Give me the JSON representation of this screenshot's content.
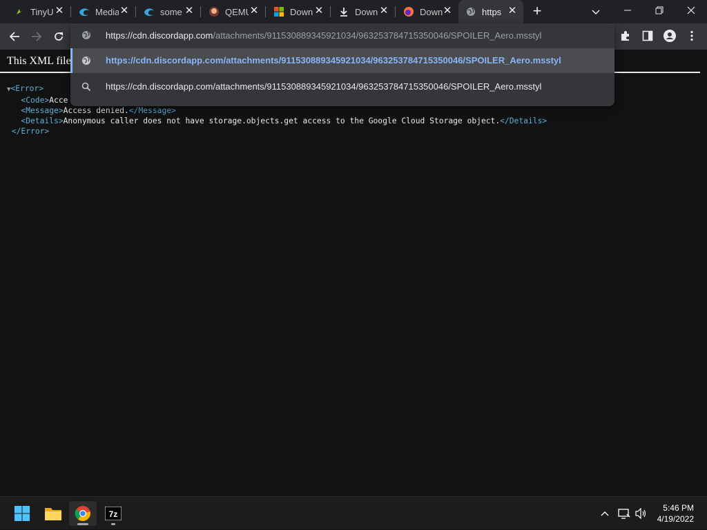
{
  "tabs": [
    {
      "title": "TinyU",
      "icon": "tinyurl-icon",
      "active": false
    },
    {
      "title": "Media",
      "icon": "edge-icon",
      "active": false
    },
    {
      "title": "some",
      "icon": "edge-icon",
      "active": false
    },
    {
      "title": "QEMU",
      "icon": "qemu-icon",
      "active": false
    },
    {
      "title": "Down",
      "icon": "microsoft-icon",
      "active": false
    },
    {
      "title": "Down",
      "icon": "download-icon",
      "active": false
    },
    {
      "title": "Down",
      "icon": "firefox-icon",
      "active": false
    },
    {
      "title": "https",
      "icon": "globe-icon",
      "active": true
    }
  ],
  "omnibox": {
    "url_host": "https://cdn.discordapp.com",
    "url_path": "/attachments/911530889345921034/963253784715350046/SPOILER_Aero.msstyl",
    "suggestions": [
      {
        "text": "https://cdn.discordapp.com/attachments/911530889345921034/963253784715350046/SPOILER_Aero.msstyl",
        "kind": "url"
      },
      {
        "text": "https://cdn.discordapp.com/attachments/911530889345921034/963253784715350046/SPOILER_Aero.msstyl",
        "kind": "search"
      }
    ]
  },
  "page": {
    "banner": "This XML file",
    "xml": {
      "error_open": "<Error>",
      "code_open": "<Code>",
      "code_text": "Acce",
      "message_open": "<Message>",
      "message_text": "Access denied.",
      "message_close": "</Message>",
      "details_open": "<Details>",
      "details_text": "Anonymous caller does not have storage.objects.get access to the Google Cloud Storage object.",
      "details_close": "</Details>",
      "error_close": "</Error>"
    }
  },
  "taskbar": {
    "apps": [
      "start-icon",
      "file-explorer-icon",
      "chrome-icon",
      "7zip-icon"
    ],
    "sevenzip_label": "7z",
    "time": "5:46 PM",
    "date": "4/19/2022"
  },
  "colors": {
    "accent": "#8ab4f8",
    "xml_tag": "#5db0d7",
    "page_bg": "#121212",
    "toolbar_bg": "#35363a",
    "tabstrip_bg": "#202124"
  }
}
